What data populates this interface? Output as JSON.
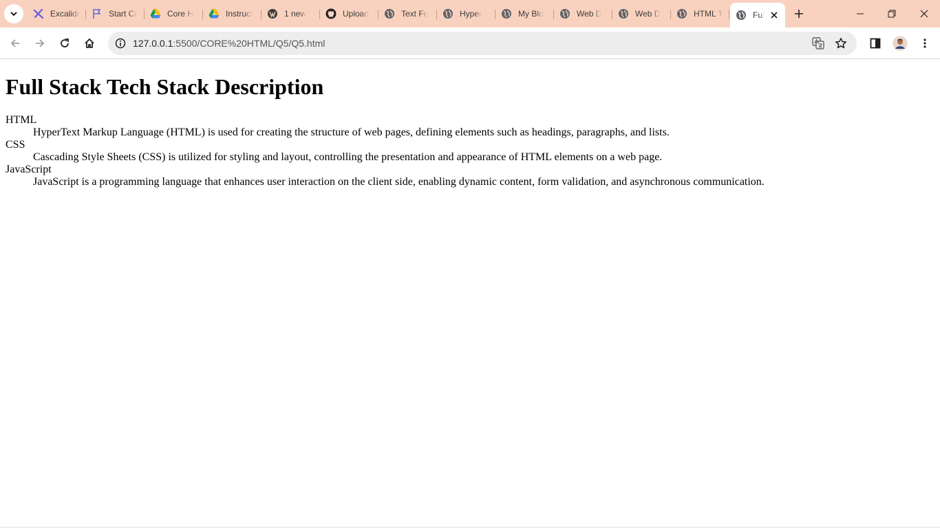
{
  "browser": {
    "tabs": [
      {
        "title": "Excalidr",
        "icon": "excalidraw-icon"
      },
      {
        "title": "Start Cr",
        "icon": "flag-icon"
      },
      {
        "title": "Core H",
        "icon": "google-drive-icon"
      },
      {
        "title": "Instruct",
        "icon": "google-drive-icon"
      },
      {
        "title": "1 new",
        "icon": "wordpress-icon"
      },
      {
        "title": "Upload",
        "icon": "github-icon"
      },
      {
        "title": "Text Fo",
        "icon": "globe-icon"
      },
      {
        "title": "Hyper",
        "icon": "globe-icon"
      },
      {
        "title": "My Blo",
        "icon": "globe-icon"
      },
      {
        "title": "Web D",
        "icon": "globe-icon"
      },
      {
        "title": "Web D",
        "icon": "globe-icon"
      },
      {
        "title": "HTML T",
        "icon": "globe-icon"
      }
    ],
    "active_tab": {
      "title": "Ful",
      "icon": "globe-icon"
    },
    "address": {
      "host": "127.0.0.1",
      "path": ":5500/CORE%20HTML/Q5/Q5.html"
    },
    "colors": {
      "tabstrip": "#f9d2bf",
      "omnibox": "#ededed"
    }
  },
  "page": {
    "title": "Full Stack Tech Stack Description",
    "definitions": [
      {
        "term": "HTML",
        "description": "HyperText Markup Language (HTML) is used for creating the structure of web pages, defining elements such as headings, paragraphs, and lists."
      },
      {
        "term": "CSS",
        "description": "Cascading Style Sheets (CSS) is utilized for styling and layout, controlling the presentation and appearance of HTML elements on a web page."
      },
      {
        "term": "JavaScript",
        "description": "JavaScript is a programming language that enhances user interaction on the client side, enabling dynamic content, form validation, and asynchronous communication."
      }
    ]
  }
}
